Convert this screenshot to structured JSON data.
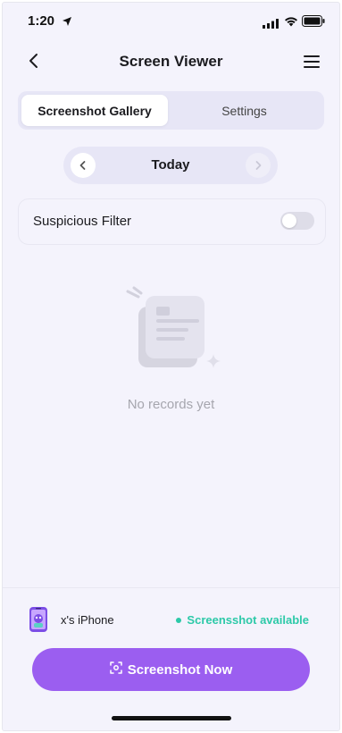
{
  "status": {
    "time": "1:20"
  },
  "header": {
    "title": "Screen Viewer"
  },
  "tabs": [
    {
      "label": "Screenshot Gallery",
      "active": true
    },
    {
      "label": "Settings",
      "active": false
    }
  ],
  "day_nav": {
    "label": "Today"
  },
  "filter": {
    "label": "Suspicious Filter",
    "enabled": false
  },
  "empty_state": {
    "text": "No records yet"
  },
  "device": {
    "name": "x's iPhone",
    "status": "Screensshot available"
  },
  "actions": {
    "screenshot_label": "Screenshot Now"
  },
  "colors": {
    "accent": "#9b5ef0",
    "status_green": "#2cc9a8",
    "background": "#f4f3fc",
    "segment_bg": "#e7e6f6"
  },
  "icons": [
    "location-arrow-icon",
    "signal-icon",
    "wifi-icon",
    "battery-icon",
    "back-chevron-icon",
    "menu-icon",
    "chevron-left-icon",
    "chevron-right-icon",
    "empty-documents-icon",
    "device-phone-icon",
    "screenshot-capture-icon"
  ]
}
